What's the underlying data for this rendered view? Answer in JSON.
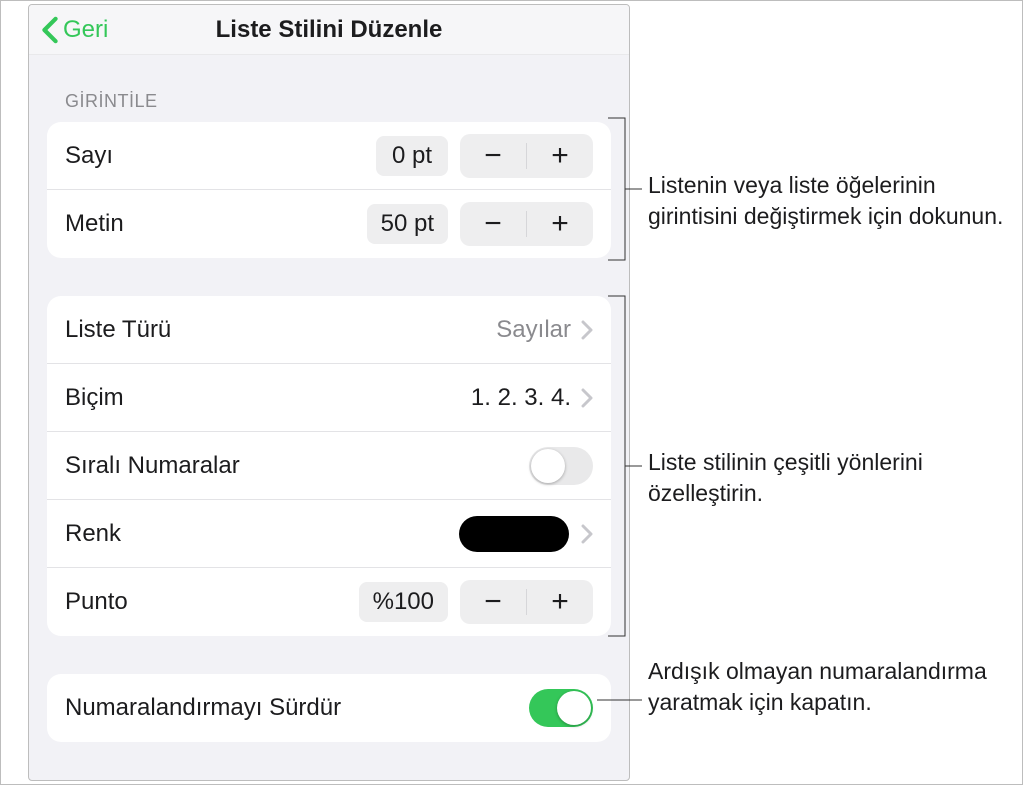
{
  "header": {
    "back_label": "Geri",
    "title": "Liste Stilini Düzenle"
  },
  "sections": {
    "indent": {
      "label": "GİRİNTİLE",
      "number_label": "Sayı",
      "number_value": "0 pt",
      "text_label": "Metin",
      "text_value": "50 pt"
    },
    "style": {
      "list_type_label": "Liste Türü",
      "list_type_value": "Sayılar",
      "format_label": "Biçim",
      "format_value": "1. 2. 3. 4.",
      "tiered_label": "Sıralı Numaralar",
      "tiered_on": false,
      "color_label": "Renk",
      "color_value": "#000000",
      "size_label": "Punto",
      "size_value": "%100"
    },
    "continue": {
      "label": "Numaralandırmayı Sürdür",
      "on": true
    }
  },
  "callouts": {
    "indent_text": "Listenin veya liste öğelerinin girintisini değiştirmek için dokunun.",
    "style_text": "Liste stilinin çeşitli yönlerini özelleştirin.",
    "continue_text": "Ardışık olmayan numaralandırma yaratmak için kapatın."
  }
}
